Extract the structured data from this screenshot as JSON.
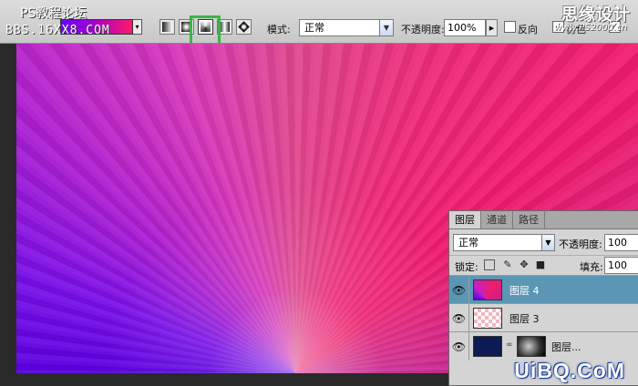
{
  "watermark": {
    "site_title": "PS教程论坛",
    "site_url": "BBS.16XX8.COM",
    "top_logo": "思缘设计",
    "top_logo_url": "www.PS2000.cn",
    "bottom_logo": "UiBQ.CoM"
  },
  "options_bar": {
    "gradient_mode_buttons": [
      "linear-gradient",
      "radial-gradient",
      "angle-gradient",
      "reflected-gradient",
      "diamond-gradient"
    ],
    "active_mode": "angle-gradient",
    "mode_label": "模式:",
    "mode_value": "正常",
    "opacity_label": "不透明度:",
    "opacity_value": "100%",
    "reverse_label": "反向",
    "reverse_checked": false,
    "dither_label": "仿色",
    "dither_checked": true,
    "transparency_checked": true
  },
  "layers_panel": {
    "tabs": [
      "图层",
      "通道",
      "路径"
    ],
    "active_tab": "图层",
    "blend_mode": "正常",
    "opacity_label": "不透明度:",
    "opacity_value": "100",
    "lock_label": "锁定:",
    "fill_label": "填充:",
    "fill_value": "100",
    "layers": [
      {
        "name": "图层 4",
        "selected": true,
        "thumb": "gradient"
      },
      {
        "name": "图层 3",
        "selected": false,
        "thumb": "transparent"
      },
      {
        "name": "图层...",
        "selected": false,
        "thumb": "navy-with-mask"
      }
    ]
  },
  "colors": {
    "canvas_violet": "#5a00e0",
    "canvas_magenta": "#c020c8",
    "canvas_pink": "#f01c6c",
    "selected_layer": "#5b97b5",
    "highlight_box": "#3cb44a"
  }
}
